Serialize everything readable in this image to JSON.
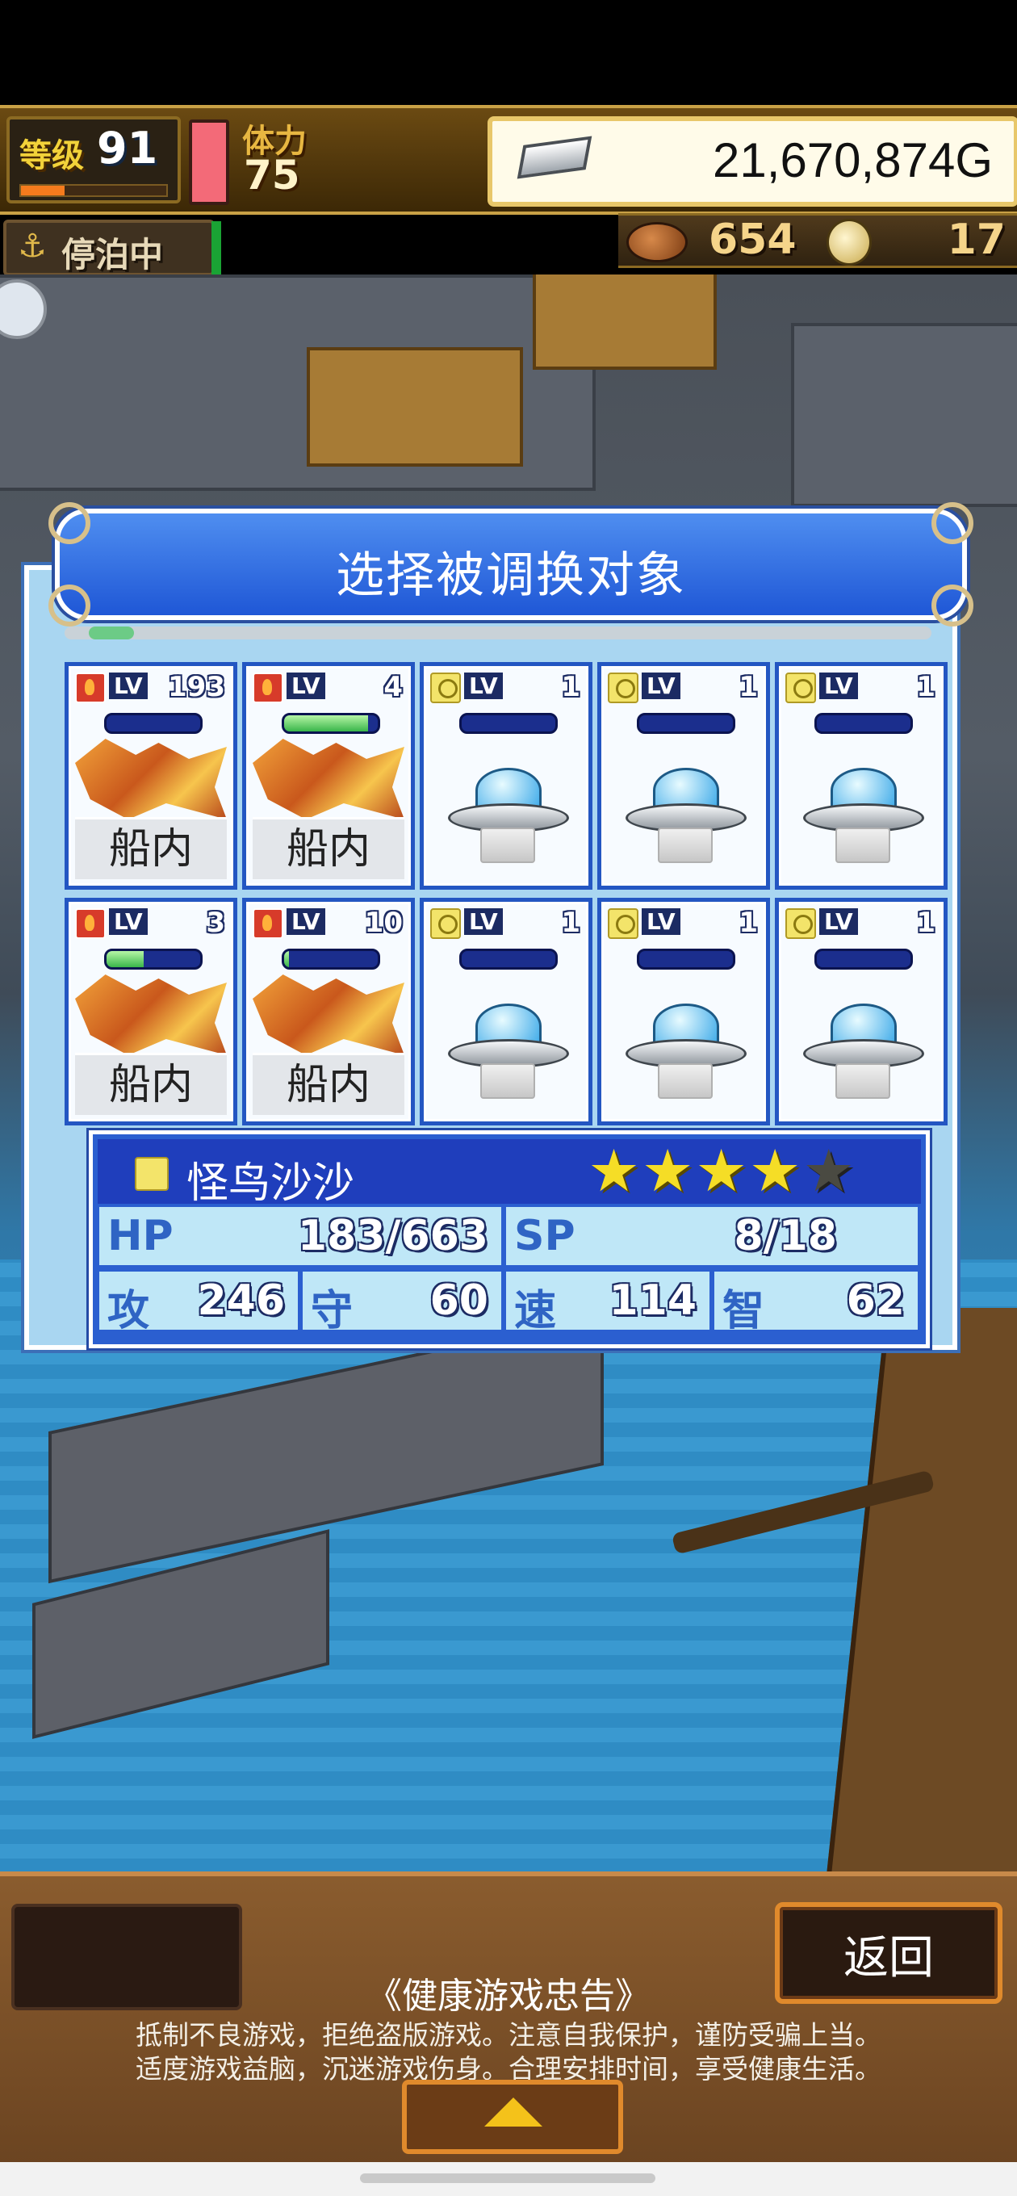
{
  "hud": {
    "level_label": "等级",
    "level": "91",
    "stamina_label": "体力",
    "stamina": "75",
    "gold": "21,670,874G",
    "mooring_status": "停泊中",
    "food": "654",
    "coins": "17"
  },
  "dialog": {
    "title": "选择被调换对象",
    "cards": [
      {
        "element": "fire",
        "lv_label": "LV",
        "level": "193",
        "hp": 0,
        "creature": "dragon",
        "location": "船内"
      },
      {
        "element": "fire",
        "lv_label": "LV",
        "level": "4",
        "hp": 0.9,
        "creature": "dragon",
        "location": "船内"
      },
      {
        "element": "bolt",
        "lv_label": "LV",
        "level": "1",
        "hp": 0,
        "creature": "ufo",
        "location": ""
      },
      {
        "element": "bolt",
        "lv_label": "LV",
        "level": "1",
        "hp": 0,
        "creature": "ufo",
        "location": ""
      },
      {
        "element": "bolt",
        "lv_label": "LV",
        "level": "1",
        "hp": 0,
        "creature": "ufo",
        "location": ""
      },
      {
        "element": "fire",
        "lv_label": "LV",
        "level": "3",
        "hp": 0.4,
        "creature": "dragon",
        "location": "船内"
      },
      {
        "element": "fire",
        "lv_label": "LV",
        "level": "10",
        "hp": 0.05,
        "creature": "dragon",
        "location": "船内"
      },
      {
        "element": "bolt",
        "lv_label": "LV",
        "level": "1",
        "hp": 0,
        "creature": "ufo",
        "location": ""
      },
      {
        "element": "bolt",
        "lv_label": "LV",
        "level": "1",
        "hp": 0,
        "creature": "ufo",
        "location": ""
      },
      {
        "element": "bolt",
        "lv_label": "LV",
        "level": "1",
        "hp": 0,
        "creature": "ufo",
        "location": ""
      }
    ]
  },
  "info": {
    "name": "怪鸟沙沙",
    "stars_filled": 4,
    "stars_total": 5,
    "hp_label": "HP",
    "hp": "183/663",
    "sp_label": "SP",
    "sp": "8/18",
    "atk_label": "攻",
    "atk": "246",
    "def_label": "守",
    "def": "60",
    "spd_label": "速",
    "spd": "114",
    "int_label": "智",
    "int": "62"
  },
  "footer": {
    "back_label": "返回",
    "notice_title": "《健康游戏忠告》",
    "notice_line1": "抵制不良游戏，拒绝盗版游戏。注意自我保护，谨防受骗上当。",
    "notice_line2": "适度游戏益脑，沉迷游戏伤身。合理安排时间，享受健康生活。"
  },
  "colors": {
    "dialog_blue": "#2356c2",
    "gold_text": "#f2d23a",
    "star": "#f5dd26"
  }
}
